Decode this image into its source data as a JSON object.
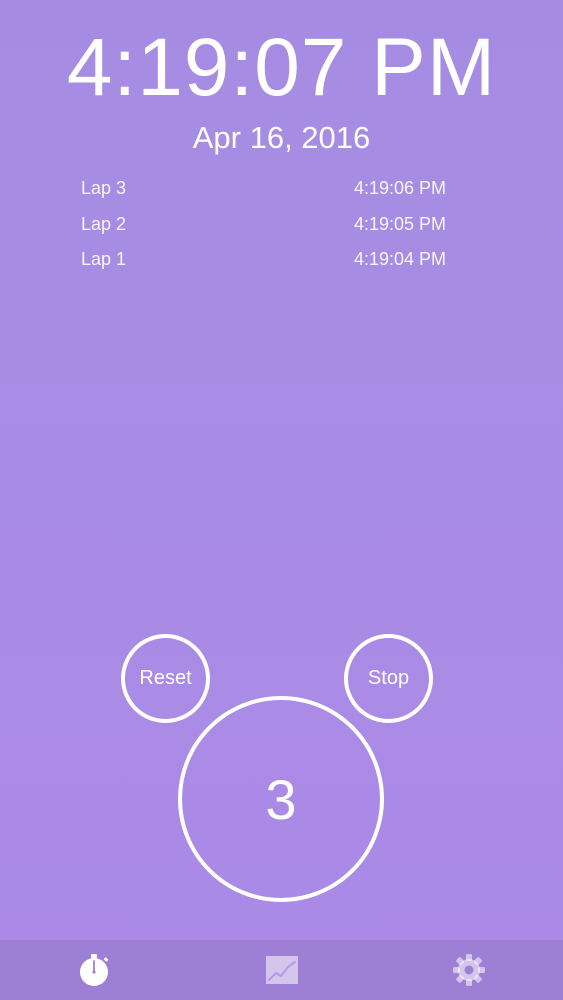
{
  "clock": {
    "time": "4:19:07 PM",
    "date": "Apr 16, 2016"
  },
  "laps": [
    {
      "label": "Lap 3",
      "time": "4:19:06 PM"
    },
    {
      "label": "Lap 2",
      "time": "4:19:05 PM"
    },
    {
      "label": "Lap 1",
      "time": "4:19:04 PM"
    }
  ],
  "controls": {
    "reset_label": "Reset",
    "stop_label": "Stop",
    "lap_count": "3"
  },
  "tabbar": {
    "tabs": [
      {
        "icon": "stopwatch-icon",
        "active": true
      },
      {
        "icon": "chart-icon",
        "active": false
      },
      {
        "icon": "gear-icon",
        "active": false
      }
    ]
  },
  "colors": {
    "background": "#a78be4",
    "tabbar": "#9e7fd6",
    "foreground": "#ffffff"
  }
}
